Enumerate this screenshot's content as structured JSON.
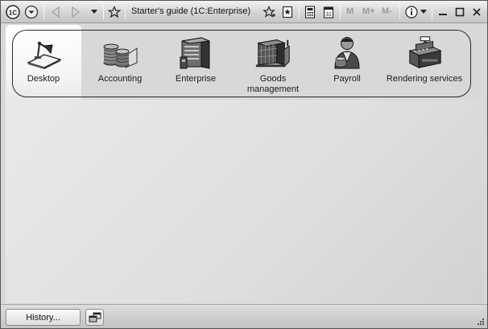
{
  "window": {
    "title": "Starter's guide  (1C:Enterprise)",
    "app_logo": "1C"
  },
  "toolbar": {
    "memory_buttons": [
      "M",
      "M+",
      "M-"
    ]
  },
  "sections": {
    "active_index": 0,
    "items": [
      {
        "label": "Desktop",
        "icon": "desktop-lamp-icon"
      },
      {
        "label": "Accounting",
        "icon": "coins-icon"
      },
      {
        "label": "Enterprise",
        "icon": "building-icon"
      },
      {
        "label": "Goods management",
        "icon": "warehouse-icon"
      },
      {
        "label": "Payroll",
        "icon": "worker-icon"
      },
      {
        "label": "Rendering services",
        "icon": "cash-register-icon"
      }
    ]
  },
  "bottom": {
    "history_label": "History..."
  },
  "colors": {
    "frame": "#2a2a2a",
    "workarea": "#e3e3e3",
    "titlebar": "#d4d4d4"
  }
}
